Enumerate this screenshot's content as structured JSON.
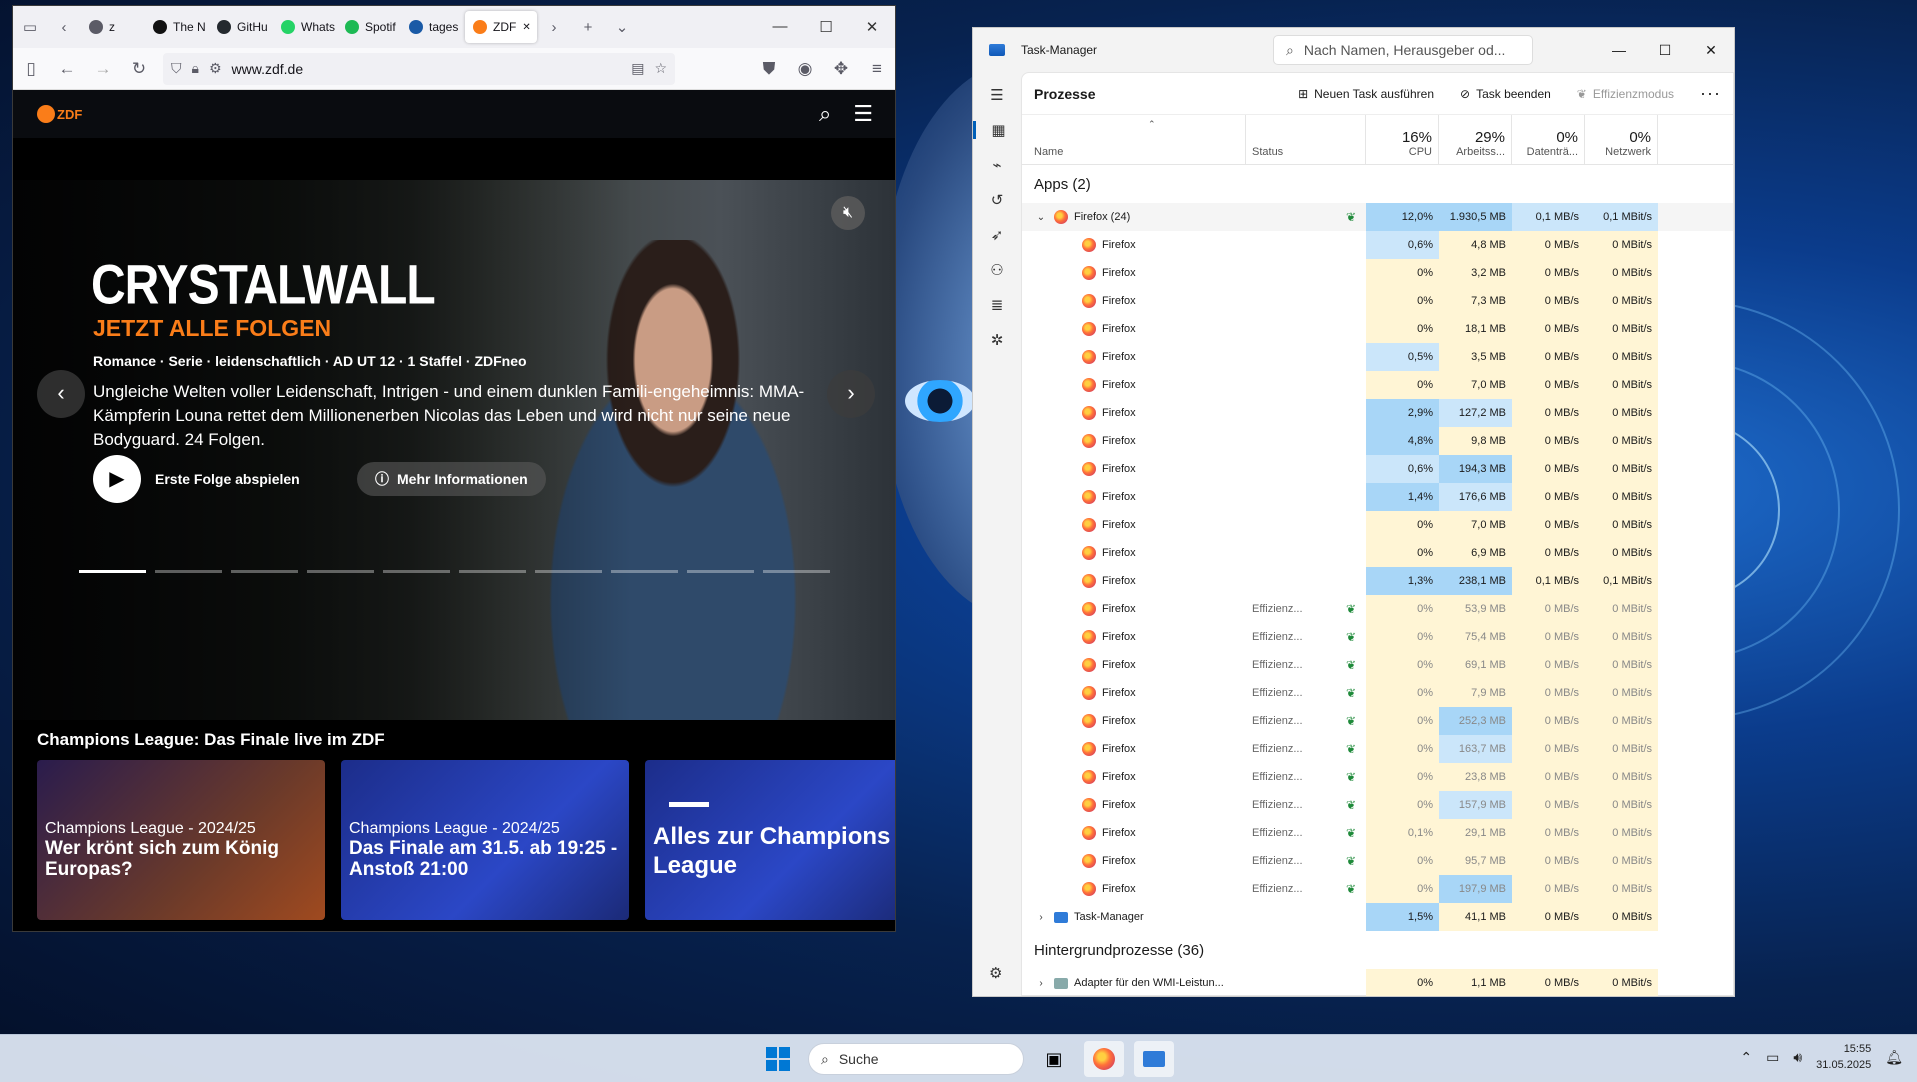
{
  "firefox": {
    "tabs": [
      {
        "label": "z",
        "color": "#5b5b66"
      },
      {
        "label": "The N",
        "color": "#111111"
      },
      {
        "label": "GitHu",
        "color": "#24292e"
      },
      {
        "label": "Whats",
        "color": "#25d366"
      },
      {
        "label": "Spotif",
        "color": "#1db954"
      },
      {
        "label": "tages",
        "color": "#1a5aa6"
      },
      {
        "label": "ZDF",
        "color": "#fa7d19"
      }
    ],
    "url": "www.zdf.de"
  },
  "zdf": {
    "logo": "ZDF",
    "hero": {
      "title": "CRYSTALWALL",
      "subtitle": "JETZT ALLE FOLGEN",
      "meta": "Romance · Serie · leidenschaftlich ·  AD   UT   12  · 1 Staffel · ZDFneo",
      "description": "Ungleiche Welten voller Leidenschaft, Intrigen - und einem dunklen Famili-engeheimnis: MMA-Kämpferin Louna rettet dem Millionenerben Nicolas das Leben und wird nicht nur seine neue Bodyguard. 24 Folgen.",
      "play_label": "Erste Folge abspielen",
      "info_label": "Mehr Informationen"
    },
    "row_title": "Champions League: Das Finale live im ZDF",
    "teasers": [
      {
        "kicker": "Champions League - 2024/25",
        "headline": "Wer krönt sich zum König Europas?"
      },
      {
        "kicker": "Champions League - 2024/25",
        "headline": "Das Finale am 31.5. ab 19:25 - Anstoß 21:00"
      },
      {
        "kicker": "",
        "headline": "Alles zur Champions League"
      }
    ]
  },
  "taskmanager": {
    "title": "Task-Manager",
    "search_placeholder": "Nach Namen, Herausgeber od...",
    "page_title": "Prozesse",
    "actions": {
      "new_task": "Neuen Task ausführen",
      "end_task": "Task beenden",
      "efficiency": "Effizienzmodus"
    },
    "columns": {
      "name": "Name",
      "status": "Status",
      "cpu": {
        "pct": "16%",
        "label": "CPU"
      },
      "mem": {
        "pct": "29%",
        "label": "Arbeitss..."
      },
      "disk": {
        "pct": "0%",
        "label": "Datenträ..."
      },
      "net": {
        "pct": "0%",
        "label": "Netzwerk"
      }
    },
    "apps_label": "Apps (2)",
    "firefox_group": {
      "name": "Firefox (24)",
      "cpu": "12,0%",
      "mem": "1.930,5 MB",
      "disk": "0,1 MB/s",
      "net": "0,1 MBit/s"
    },
    "processes": [
      {
        "name": "Firefox",
        "status": "",
        "cpu": "0,6%",
        "mem": "4,8 MB",
        "disk": "0 MB/s",
        "net": "0 MBit/s"
      },
      {
        "name": "Firefox",
        "status": "",
        "cpu": "0%",
        "mem": "3,2 MB",
        "disk": "0 MB/s",
        "net": "0 MBit/s"
      },
      {
        "name": "Firefox",
        "status": "",
        "cpu": "0%",
        "mem": "7,3 MB",
        "disk": "0 MB/s",
        "net": "0 MBit/s"
      },
      {
        "name": "Firefox",
        "status": "",
        "cpu": "0%",
        "mem": "18,1 MB",
        "disk": "0 MB/s",
        "net": "0 MBit/s"
      },
      {
        "name": "Firefox",
        "status": "",
        "cpu": "0,5%",
        "mem": "3,5 MB",
        "disk": "0 MB/s",
        "net": "0 MBit/s"
      },
      {
        "name": "Firefox",
        "status": "",
        "cpu": "0%",
        "mem": "7,0 MB",
        "disk": "0 MB/s",
        "net": "0 MBit/s"
      },
      {
        "name": "Firefox",
        "status": "",
        "cpu": "2,9%",
        "mem": "127,2 MB",
        "disk": "0 MB/s",
        "net": "0 MBit/s"
      },
      {
        "name": "Firefox",
        "status": "",
        "cpu": "4,8%",
        "mem": "9,8 MB",
        "disk": "0 MB/s",
        "net": "0 MBit/s"
      },
      {
        "name": "Firefox",
        "status": "",
        "cpu": "0,6%",
        "mem": "194,3 MB",
        "disk": "0 MB/s",
        "net": "0 MBit/s"
      },
      {
        "name": "Firefox",
        "status": "",
        "cpu": "1,4%",
        "mem": "176,6 MB",
        "disk": "0 MB/s",
        "net": "0 MBit/s"
      },
      {
        "name": "Firefox",
        "status": "",
        "cpu": "0%",
        "mem": "7,0 MB",
        "disk": "0 MB/s",
        "net": "0 MBit/s"
      },
      {
        "name": "Firefox",
        "status": "",
        "cpu": "0%",
        "mem": "6,9 MB",
        "disk": "0 MB/s",
        "net": "0 MBit/s"
      },
      {
        "name": "Firefox",
        "status": "",
        "cpu": "1,3%",
        "mem": "238,1 MB",
        "disk": "0,1 MB/s",
        "net": "0,1 MBit/s"
      },
      {
        "name": "Firefox",
        "status": "Effizienz...",
        "cpu": "0%",
        "mem": "53,9 MB",
        "disk": "0 MB/s",
        "net": "0 MBit/s"
      },
      {
        "name": "Firefox",
        "status": "Effizienz...",
        "cpu": "0%",
        "mem": "75,4 MB",
        "disk": "0 MB/s",
        "net": "0 MBit/s"
      },
      {
        "name": "Firefox",
        "status": "Effizienz...",
        "cpu": "0%",
        "mem": "69,1 MB",
        "disk": "0 MB/s",
        "net": "0 MBit/s"
      },
      {
        "name": "Firefox",
        "status": "Effizienz...",
        "cpu": "0%",
        "mem": "7,9 MB",
        "disk": "0 MB/s",
        "net": "0 MBit/s"
      },
      {
        "name": "Firefox",
        "status": "Effizienz...",
        "cpu": "0%",
        "mem": "252,3 MB",
        "disk": "0 MB/s",
        "net": "0 MBit/s"
      },
      {
        "name": "Firefox",
        "status": "Effizienz...",
        "cpu": "0%",
        "mem": "163,7 MB",
        "disk": "0 MB/s",
        "net": "0 MBit/s"
      },
      {
        "name": "Firefox",
        "status": "Effizienz...",
        "cpu": "0%",
        "mem": "23,8 MB",
        "disk": "0 MB/s",
        "net": "0 MBit/s"
      },
      {
        "name": "Firefox",
        "status": "Effizienz...",
        "cpu": "0%",
        "mem": "157,9 MB",
        "disk": "0 MB/s",
        "net": "0 MBit/s"
      },
      {
        "name": "Firefox",
        "status": "Effizienz...",
        "cpu": "0,1%",
        "mem": "29,1 MB",
        "disk": "0 MB/s",
        "net": "0 MBit/s"
      },
      {
        "name": "Firefox",
        "status": "Effizienz...",
        "cpu": "0%",
        "mem": "95,7 MB",
        "disk": "0 MB/s",
        "net": "0 MBit/s"
      },
      {
        "name": "Firefox",
        "status": "Effizienz...",
        "cpu": "0%",
        "mem": "197,9 MB",
        "disk": "0 MB/s",
        "net": "0 MBit/s"
      }
    ],
    "taskmgr_row": {
      "name": "Task-Manager",
      "cpu": "1,5%",
      "mem": "41,1 MB",
      "disk": "0 MB/s",
      "net": "0 MBit/s"
    },
    "bg_label": "Hintergrundprozesse (36)",
    "bg_first": {
      "name": "Adapter für den WMI-Leistun...",
      "cpu": "0%",
      "mem": "1,1 MB",
      "disk": "0 MB/s",
      "net": "0 MBit/s"
    }
  },
  "taskbar": {
    "search_placeholder": "Suche",
    "time": "15:55",
    "date": "31.05.2025"
  }
}
